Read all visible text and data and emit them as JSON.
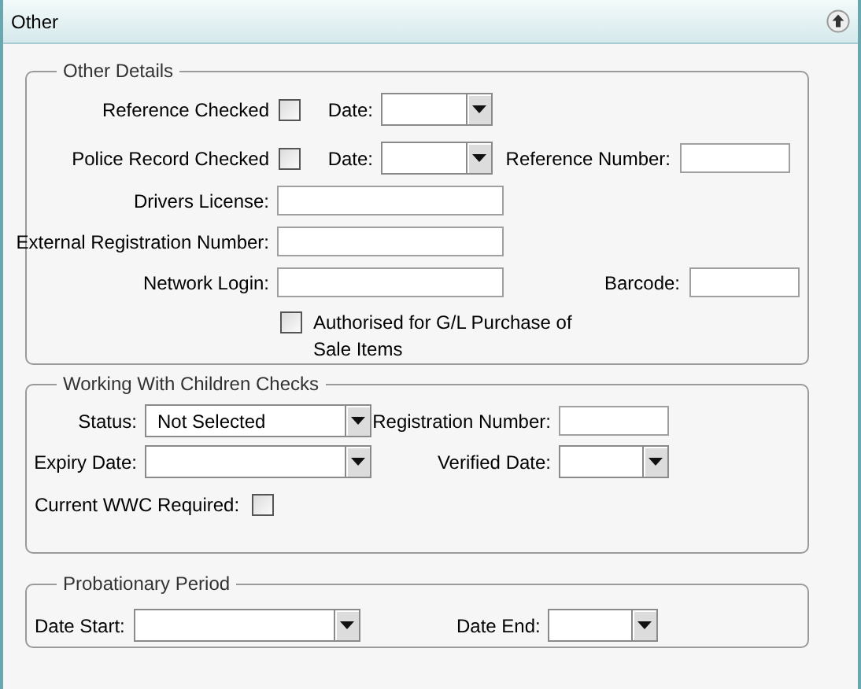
{
  "panel": {
    "title": "Other"
  },
  "other_details": {
    "legend": "Other Details",
    "reference_checked": {
      "label": "Reference Checked",
      "checked": false
    },
    "reference_date": {
      "label": "Date:"
    },
    "police_record_checked": {
      "label": "Police Record Checked",
      "checked": false
    },
    "police_record_date": {
      "label": "Date:"
    },
    "reference_number": {
      "label": "Reference Number:"
    },
    "drivers_license": {
      "label": "Drivers License:"
    },
    "external_registration_number": {
      "label": "External Registration Number:"
    },
    "network_login": {
      "label": "Network Login:"
    },
    "barcode": {
      "label": "Barcode:"
    },
    "authorised_gl_purchase": {
      "label": "Authorised for G/L Purchase of Sale Items",
      "checked": false
    }
  },
  "working_with_children_checks": {
    "legend": "Working With Children Checks",
    "status": {
      "label": "Status:",
      "value": "Not Selected"
    },
    "registration_number": {
      "label": "Registration Number:"
    },
    "expiry_date": {
      "label": "Expiry Date:"
    },
    "verified_date": {
      "label": "Verified Date:"
    },
    "current_wwc_required": {
      "label": "Current WWC Required:",
      "checked": false
    }
  },
  "probationary_period": {
    "legend": "Probationary Period",
    "date_start": {
      "label": "Date Start:"
    },
    "date_end": {
      "label": "Date End:"
    }
  }
}
